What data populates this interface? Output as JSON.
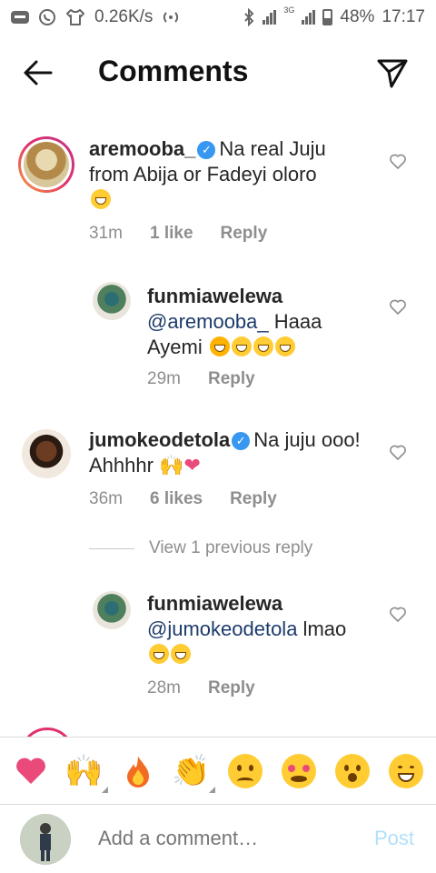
{
  "status": {
    "speed": "0.26K/s",
    "network": "3G",
    "battery": "48%",
    "time": "17:17"
  },
  "header": {
    "title": "Comments"
  },
  "comments": [
    {
      "username": "aremooba_",
      "verified": true,
      "text": "Na real Juju from Abija or Fadeyi oloro",
      "time": "31m",
      "likes": "1 like",
      "reply": "Reply"
    },
    {
      "username": "funmiawelewa",
      "mention": "@aremooba_",
      "text": " Haaa Ayemi",
      "time": "29m",
      "reply": "Reply"
    },
    {
      "username": "jumokeodetola",
      "verified": true,
      "text": "Na juju ooo! Ahhhhr",
      "time": "36m",
      "likes": "6 likes",
      "reply": "Reply"
    },
    {
      "username": "funmiawelewa",
      "mention": "@jumokeodetola",
      "text": " lmao",
      "time": "28m",
      "reply": "Reply"
    }
  ],
  "view_replies": "View 1 previous reply",
  "emoji_bar": [
    "heart",
    "raised-hands",
    "fire",
    "clapping-hands",
    "sad-face",
    "heart-eyes",
    "surprised-face",
    "grinning-squint"
  ],
  "add_comment": {
    "placeholder": "Add a comment…",
    "post_label": "Post"
  },
  "colors": {
    "verified": "#3897f0",
    "mention": "#1c3b6b",
    "meta": "#8e8e8e",
    "post_disabled": "#b2dffc",
    "heart_emoji": "#e94a7a"
  }
}
